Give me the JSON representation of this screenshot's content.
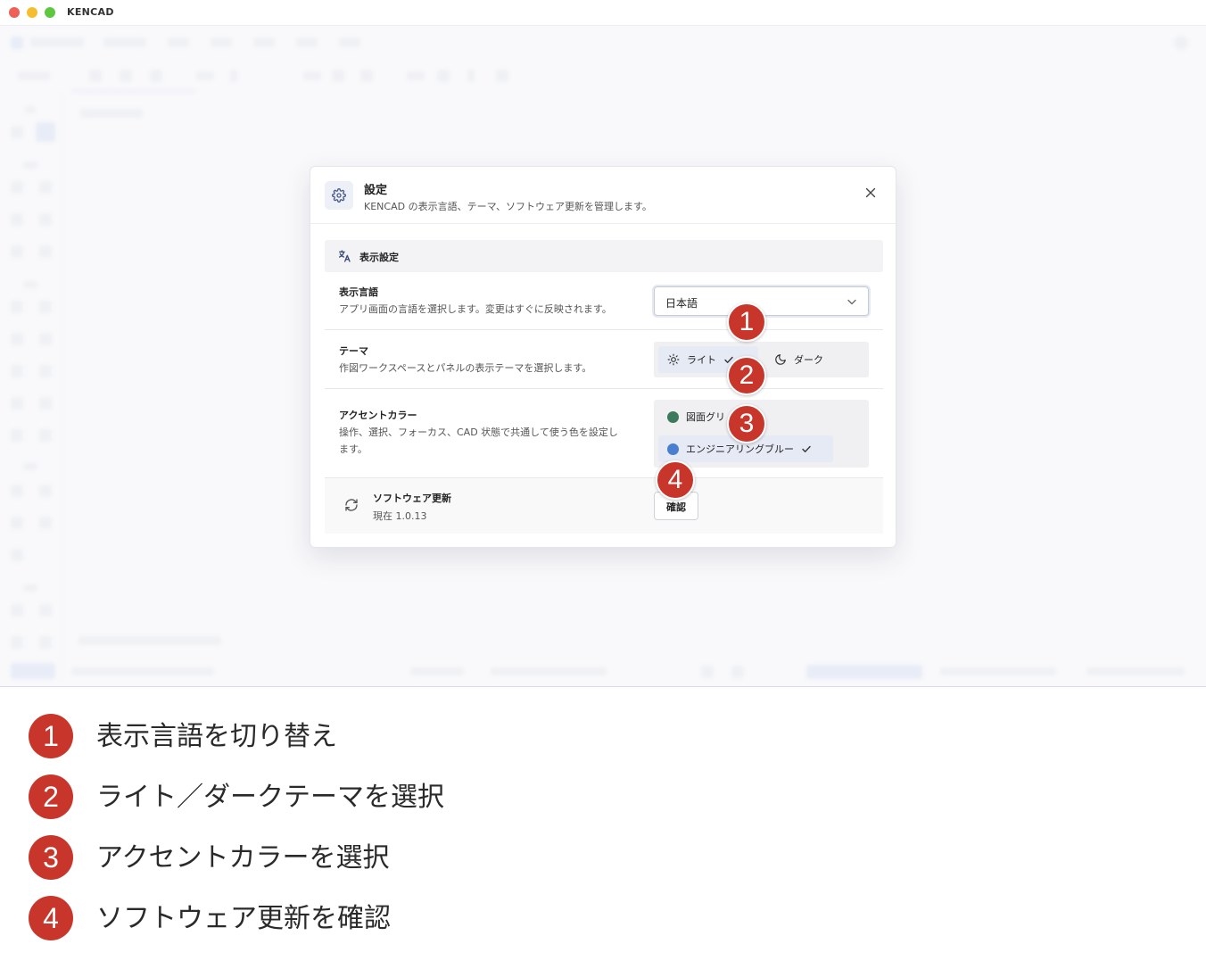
{
  "window": {
    "title": "KENCAD"
  },
  "dialog": {
    "title": "設定",
    "subtitle": "KENCAD の表示言語、テーマ、ソフトウェア更新を管理します。",
    "section_title": "表示設定",
    "language": {
      "label": "表示言語",
      "description": "アプリ画面の言語を選択します。変更はすぐに反映されます。",
      "selected": "日本語"
    },
    "theme": {
      "label": "テーマ",
      "description": "作図ワークスペースとパネルの表示テーマを選択します。",
      "options": [
        {
          "label": "ライト",
          "selected": true,
          "icon": "sun-icon"
        },
        {
          "label": "ダーク",
          "selected": false,
          "icon": "moon-icon"
        }
      ]
    },
    "accent": {
      "label": "アクセントカラー",
      "description_line1": "操作、選択、フォーカス、CAD 状態で共通して使う色を設定し",
      "description_line2": "ます。",
      "options": [
        {
          "label": "図面グリ",
          "color": "#3b7a5c",
          "selected": false
        },
        {
          "label": "エンジニアリングブルー",
          "color": "#4a7fd0",
          "selected": true
        }
      ]
    },
    "update": {
      "label": "ソフトウェア更新",
      "version": "現在 1.0.13",
      "button": "確認"
    }
  },
  "markers": [
    "1",
    "2",
    "3",
    "4"
  ],
  "legend": [
    {
      "num": "1",
      "text": "表示言語を切り替え"
    },
    {
      "num": "2",
      "text": "ライト／ダークテーマを選択"
    },
    {
      "num": "3",
      "text": "アクセントカラーを選択"
    },
    {
      "num": "4",
      "text": "ソフトウェア更新を確認"
    }
  ],
  "colors": {
    "marker": "#c8362b",
    "selected_bg": "#e6eaf4"
  }
}
